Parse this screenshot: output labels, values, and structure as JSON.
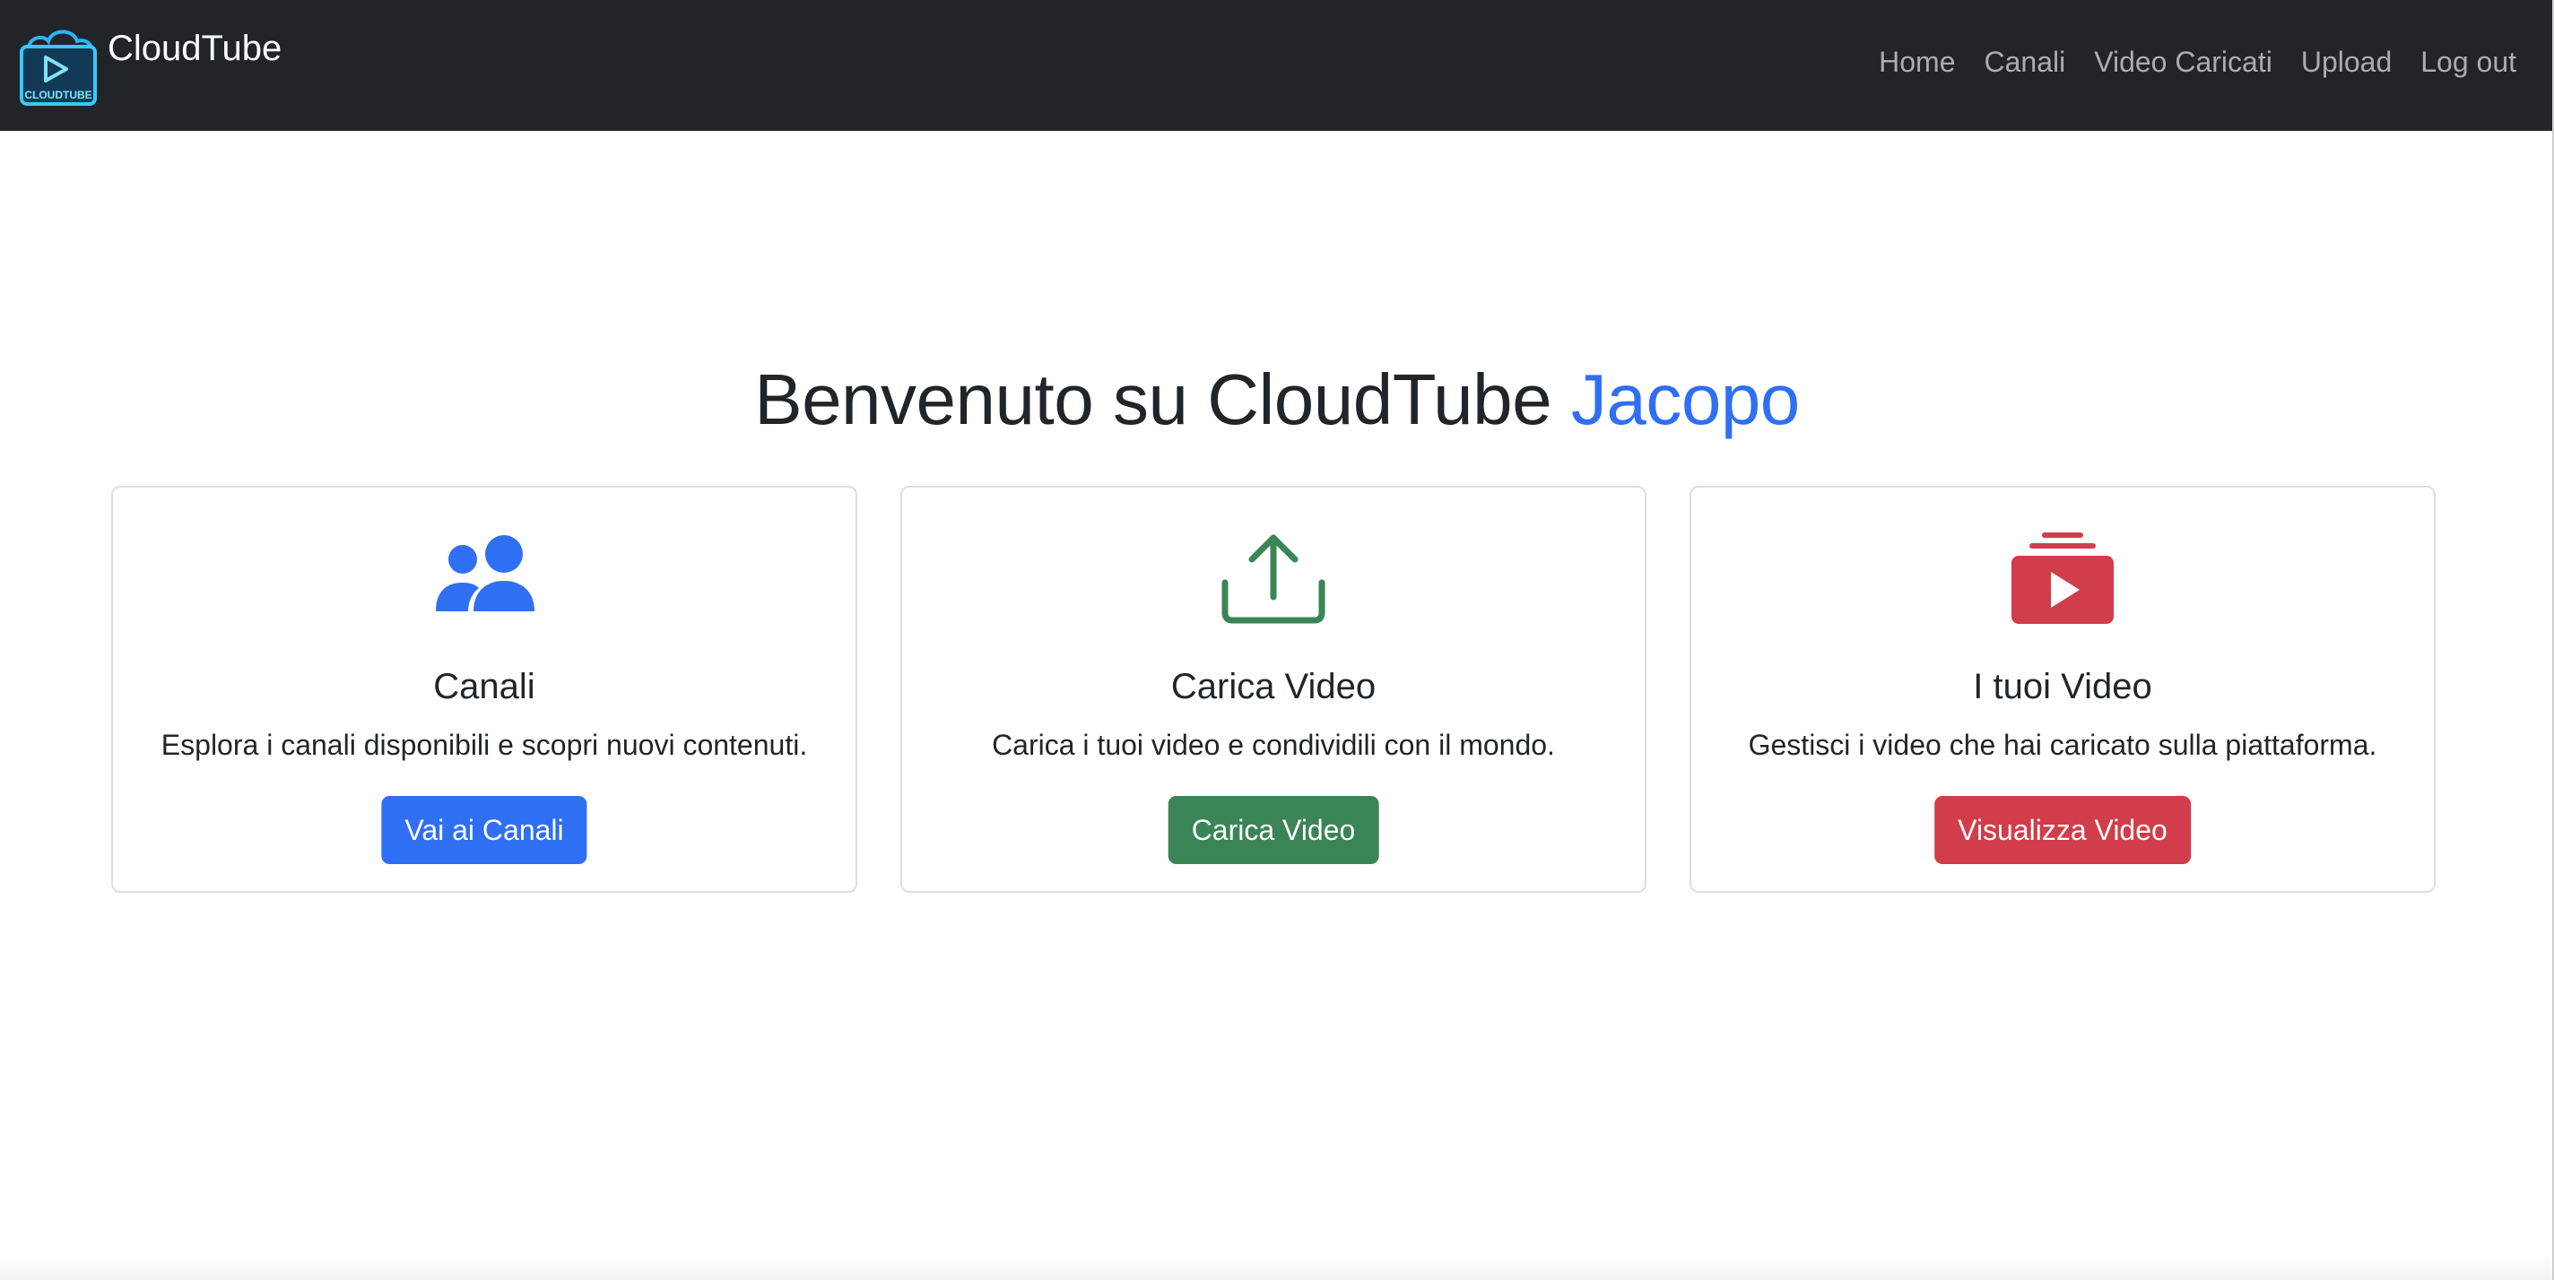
{
  "brand": {
    "name": "CloudTube",
    "logo_icon": "cloudtube-logo-icon",
    "logo_text": "CLOUDTUBE"
  },
  "nav": {
    "items": [
      {
        "label": "Home"
      },
      {
        "label": "Canali"
      },
      {
        "label": "Video Caricati"
      },
      {
        "label": "Upload"
      },
      {
        "label": "Log out"
      }
    ]
  },
  "hero": {
    "prefix": "Benvenuto su CloudTube",
    "user": "Jacopo"
  },
  "cards": [
    {
      "icon": "users-icon",
      "title": "Canali",
      "text": "Esplora i canali disponibili e scopri nuovi contenuti.",
      "button": "Vai ai Canali",
      "color": "#2f6ff3"
    },
    {
      "icon": "upload-icon",
      "title": "Carica Video",
      "text": "Carica i tuoi video e condividili con il mondo.",
      "button": "Carica Video",
      "color": "#3b8456"
    },
    {
      "icon": "video-collection-icon",
      "title": "I tuoi Video",
      "text": "Gestisci i video che hai caricato sulla piattaforma.",
      "button": "Visualizza Video",
      "color": "#d13d4a"
    }
  ],
  "colors": {
    "navbar_bg": "#212529",
    "accent": "#2f6ff3",
    "success": "#3b8456",
    "danger": "#d13d4a"
  }
}
